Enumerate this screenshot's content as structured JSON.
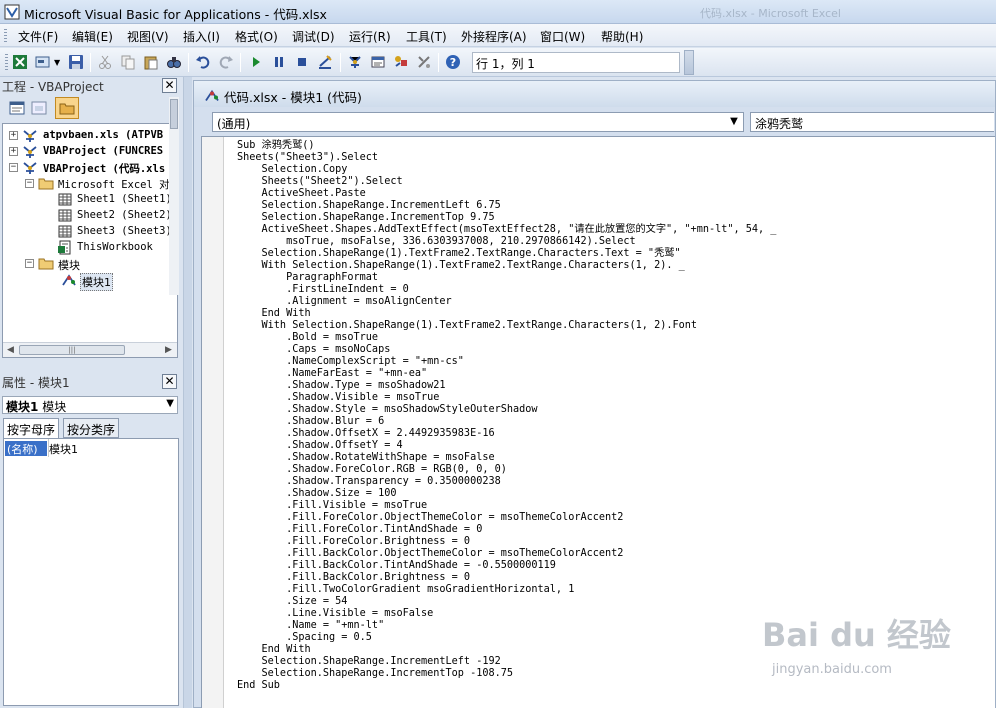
{
  "window": {
    "title": "Microsoft Visual Basic for Applications - 代码.xlsx",
    "background_title_ghost": [
      "代码.xlsx - Microsoft Excel"
    ]
  },
  "menu": {
    "items": [
      "文件(F)",
      "编辑(E)",
      "视图(V)",
      "插入(I)",
      "格式(O)",
      "调试(D)",
      "运行(R)",
      "工具(T)",
      "外接程序(A)",
      "窗口(W)",
      "帮助(H)"
    ]
  },
  "toolbar": {
    "cursor_position": "行 1，列 1"
  },
  "project_panel": {
    "title": "工程 - VBAProject",
    "tree": [
      {
        "label": "atpvbaen.xls (ATPVB",
        "bold": true
      },
      {
        "label": "VBAProject (FUNCRES",
        "bold": true
      },
      {
        "label": "VBAProject (代码.xls",
        "bold": true
      },
      {
        "label": "Microsoft Excel 对象"
      },
      {
        "label": "Sheet1 (Sheet1)"
      },
      {
        "label": "Sheet2 (Sheet2)"
      },
      {
        "label": "Sheet3 (Sheet3)"
      },
      {
        "label": "ThisWorkbook"
      },
      {
        "label": "模块"
      },
      {
        "label": "模块1",
        "selected": true
      }
    ]
  },
  "properties_panel": {
    "title": "属性 - 模块1",
    "object_combo": "模块1 模块",
    "object_combo_name": "模块1",
    "object_combo_type": "模块",
    "tabs": [
      "按字母序",
      "按分类序"
    ],
    "property_name": "(名称)",
    "property_value": "模块1"
  },
  "code_window": {
    "title": "代码.xlsx - 模块1 (代码)",
    "object_combo": "(通用)",
    "procedure_combo": "涂鸦秃鹫",
    "lines": [
      "Sub 涂鸦秃鹫()",
      "Sheets(\"Sheet3\").Select",
      "    Selection.Copy",
      "    Sheets(\"Sheet2\").Select",
      "    ActiveSheet.Paste",
      "    Selection.ShapeRange.IncrementLeft 6.75",
      "    Selection.ShapeRange.IncrementTop 9.75",
      "    ActiveSheet.Shapes.AddTextEffect(msoTextEffect28, \"请在此放置您的文字\", \"+mn-lt\", 54, _",
      "        msoTrue, msoFalse, 336.6303937008, 210.2970866142).Select",
      "    Selection.ShapeRange(1).TextFrame2.TextRange.Characters.Text = \"秃鹫\"",
      "    With Selection.ShapeRange(1).TextFrame2.TextRange.Characters(1, 2). _",
      "        ParagraphFormat",
      "        .FirstLineIndent = 0",
      "        .Alignment = msoAlignCenter",
      "    End With",
      "    With Selection.ShapeRange(1).TextFrame2.TextRange.Characters(1, 2).Font",
      "        .Bold = msoTrue",
      "        .Caps = msoNoCaps",
      "        .NameComplexScript = \"+mn-cs\"",
      "        .NameFarEast = \"+mn-ea\"",
      "        .Shadow.Type = msoShadow21",
      "        .Shadow.Visible = msoTrue",
      "        .Shadow.Style = msoShadowStyleOuterShadow",
      "        .Shadow.Blur = 6",
      "        .Shadow.OffsetX = 2.4492935983E-16",
      "        .Shadow.OffsetY = 4",
      "        .Shadow.RotateWithShape = msoFalse",
      "        .Shadow.ForeColor.RGB = RGB(0, 0, 0)",
      "        .Shadow.Transparency = 0.3500000238",
      "        .Shadow.Size = 100",
      "        .Fill.Visible = msoTrue",
      "        .Fill.ForeColor.ObjectThemeColor = msoThemeColorAccent2",
      "        .Fill.ForeColor.TintAndShade = 0",
      "        .Fill.ForeColor.Brightness = 0",
      "        .Fill.BackColor.ObjectThemeColor = msoThemeColorAccent2",
      "        .Fill.BackColor.TintAndShade = -0.5500000119",
      "        .Fill.BackColor.Brightness = 0",
      "        .Fill.TwoColorGradient msoGradientHorizontal, 1",
      "        .Size = 54",
      "        .Line.Visible = msoFalse",
      "        .Name = \"+mn-lt\"",
      "        .Spacing = 0.5",
      "    End With",
      "    Selection.ShapeRange.IncrementLeft -192",
      "    Selection.ShapeRange.IncrementTop -108.75",
      "End Sub"
    ]
  },
  "watermark": {
    "logo_text": "Bai du 经验",
    "url": "jingyan.baidu.com"
  },
  "colors": {
    "selection_blue": "#3a70c8",
    "keyword_navy": "#000080"
  }
}
